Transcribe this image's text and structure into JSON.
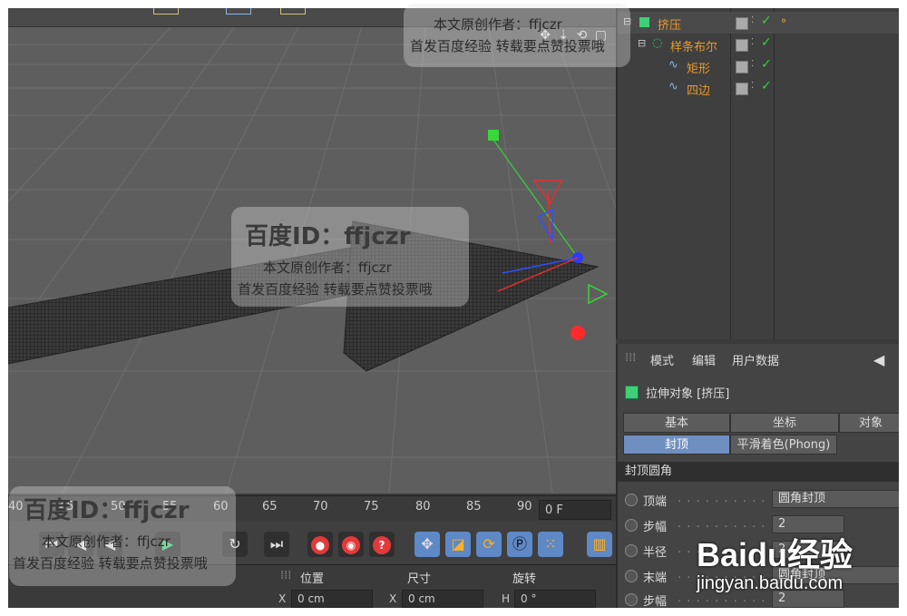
{
  "object_manager": {
    "items": [
      {
        "name": "挤压",
        "indent": 0
      },
      {
        "name": "样条布尔",
        "indent": 1
      },
      {
        "name": "矩形",
        "indent": 2
      },
      {
        "name": "四边",
        "indent": 2
      }
    ]
  },
  "attributes": {
    "menu": [
      "模式",
      "编辑",
      "用户数据"
    ],
    "object_title": "拉伸对象 [挤压]",
    "tabs_row1": [
      "基本",
      "坐标",
      "对象"
    ],
    "tabs_row2": [
      "封顶",
      "平滑着色(Phong)"
    ],
    "section_title": "封顶圆角",
    "props": [
      {
        "label": "顶端",
        "value": "圆角封顶"
      },
      {
        "label": "步幅",
        "value": "2"
      },
      {
        "label": "半径",
        "value": "2"
      },
      {
        "label": "末端",
        "value": "圆角封顶"
      },
      {
        "label": "步幅",
        "value": "2"
      }
    ]
  },
  "timeline": {
    "ticks": [
      "40",
      "45",
      "50",
      "55",
      "60",
      "65",
      "70",
      "75",
      "80",
      "85",
      "90"
    ],
    "current_frame": "0 F"
  },
  "coordinates": {
    "headers": [
      "位置",
      "尺寸",
      "旋转"
    ],
    "x_position": "0 cm",
    "x_size": "0 cm",
    "h_rotation": "0 °",
    "axis_x": "X",
    "axis_h": "H"
  },
  "watermark": {
    "id_text": "百度ID：ffjczr",
    "author_line": "本文原创作者：ffjczr",
    "notice_line": "首发百度经验  转载要点赞投票哦",
    "brand": "Baidu经验",
    "brand_url": "jingyan.baidu.com"
  },
  "colors": {
    "object_name": "#e79a2b",
    "check": "#36d13a",
    "accent_blue": "#5f89c6",
    "record_red": "#e23a3a"
  }
}
